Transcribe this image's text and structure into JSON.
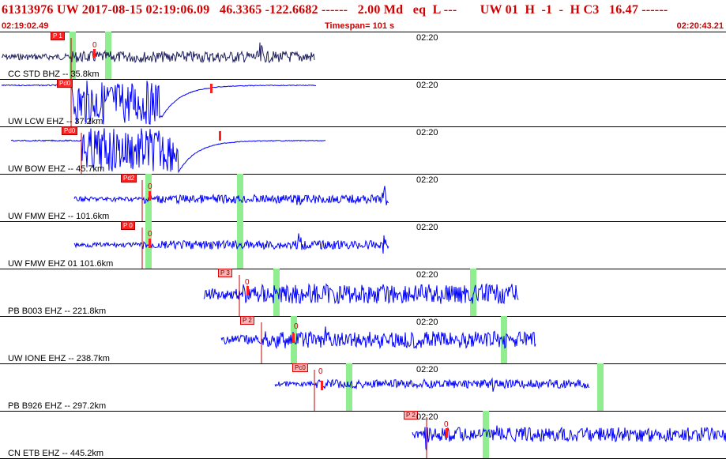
{
  "header": {
    "event_id": "61313976",
    "network": "UW",
    "origin_time": "2017-08-15 02:19:06.09",
    "latitude": "46.3365",
    "longitude": "-122.6682",
    "dashes": "------",
    "magnitude": "2.00",
    "magnitude_type": "Md",
    "event_type": "eq",
    "flag": "L ---",
    "auth": "UW 01",
    "h_flag": "H",
    "h_val": "-1",
    "dash": "-",
    "h_code": "H C3",
    "depth": "16.47",
    "trail": "------",
    "start_time": "02:19:02.49",
    "timespan": "Timespan= 101 s",
    "end_time": "02:20:43.21"
  },
  "colors": {
    "trace": "#0000ff",
    "first_trace": "#202060",
    "pick": "#ff2020",
    "green_marker": "#90ee90",
    "header_text": "#d00000"
  },
  "channels": [
    {
      "label": "CC STD BHZ -- 35.8km",
      "time_mark": "02:20",
      "pick_label": "P 1",
      "zero_label": "0"
    },
    {
      "label": "UW LCW EHZ -- 37.2km",
      "time_mark": "02:20",
      "pick_label": "Pd0",
      "zero_label": ""
    },
    {
      "label": "UW BOW EHZ -- 45.7km",
      "time_mark": "02:20",
      "pick_label": "Pd0",
      "zero_label": ""
    },
    {
      "label": "UW FMW EHZ -- 101.6km",
      "time_mark": "02:20",
      "pick_label": "Pd2",
      "zero_label": "0"
    },
    {
      "label": "UW FMW EHZ 01 101.6km",
      "time_mark": "02:20",
      "pick_label": "P 0",
      "zero_label": "0"
    },
    {
      "label": "PB B003 EHZ -- 221.8km",
      "time_mark": "02:20",
      "pick_label": "P 3",
      "zero_label": "0"
    },
    {
      "label": "UW IONE EHZ -- 238.7km",
      "time_mark": "02:20",
      "pick_label": "P 2",
      "zero_label": "0"
    },
    {
      "label": "PB B926 EHZ -- 297.2km",
      "time_mark": "02:20",
      "pick_label": "Pc0",
      "zero_label": "0"
    },
    {
      "label": "CN ETB EHZ -- 445.2km",
      "time_mark": "02:20",
      "pick_label": "P 2",
      "zero_label": "0"
    }
  ]
}
